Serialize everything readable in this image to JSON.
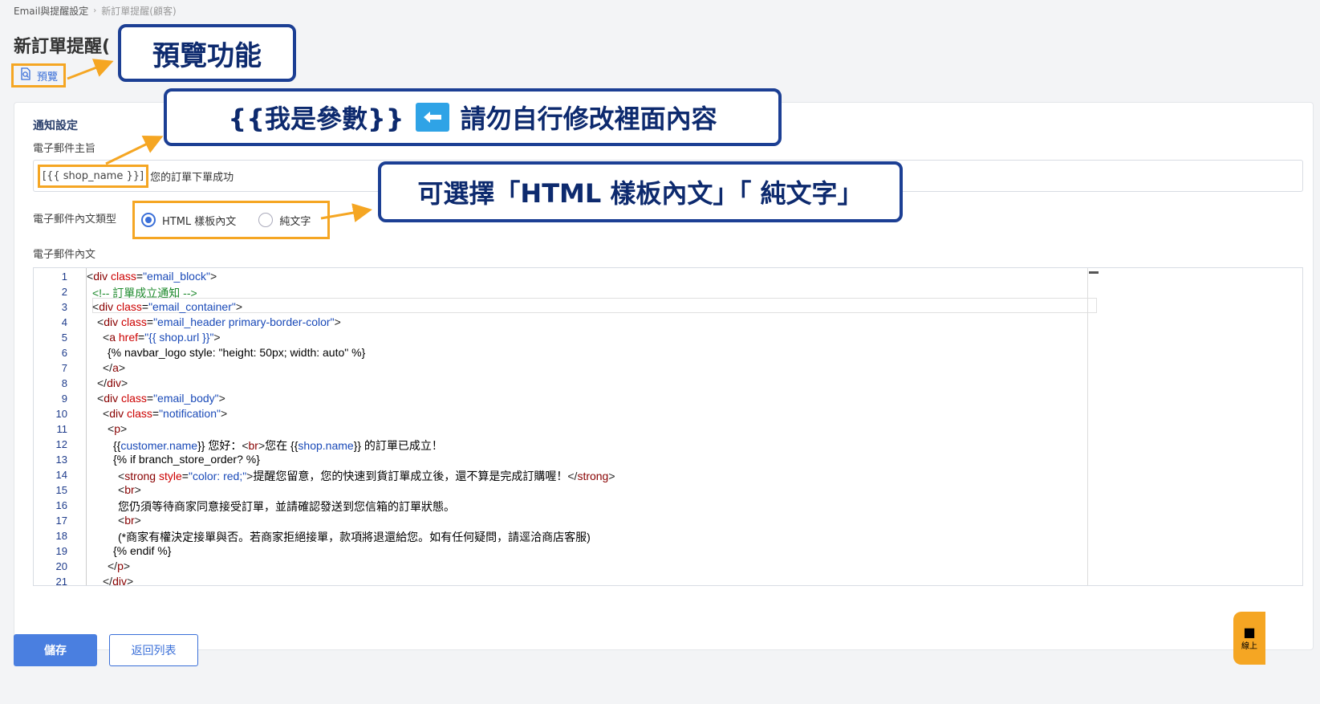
{
  "breadcrumb": {
    "parent": "Email與提醒設定",
    "current": "新訂單提醒(顧客)"
  },
  "page": {
    "title": "新訂單提醒(",
    "preview_label": "預覽"
  },
  "form": {
    "section_title": "通知設定",
    "subject_label": "電子郵件主旨",
    "subject_param": "[{{ shop_name }}]",
    "subject_rest": "您的訂單下單成功",
    "type_label": "電子郵件內文類型",
    "type_options": [
      {
        "label": "HTML 樣板內文",
        "selected": true
      },
      {
        "label": "純文字",
        "selected": false
      }
    ],
    "body_label": "電子郵件內文"
  },
  "editor": {
    "line_numbers": [
      "1",
      "2",
      "3",
      "4",
      "5",
      "6",
      "7",
      "8",
      "9",
      "10",
      "11",
      "12",
      "13",
      "14",
      "15",
      "16",
      "17",
      "18",
      "19",
      "20",
      "21"
    ]
  },
  "buttons": {
    "save": "儲存",
    "back": "返回列表"
  },
  "annotations": {
    "callout_preview": "預覽功能",
    "callout_param_left": "{{我是參數}}",
    "callout_param_right": "請勿自行修改裡面內容",
    "callout_type": "可選擇「HTML 樣板內文」「 純文字」",
    "highlight_color": "#f5a623",
    "callout_border_color": "#1c3f94"
  },
  "chat_widget": {
    "label": "線上"
  },
  "colors": {
    "primary": "#4a7fe0",
    "link": "#3a6fd8",
    "background": "#f3f4f6"
  }
}
